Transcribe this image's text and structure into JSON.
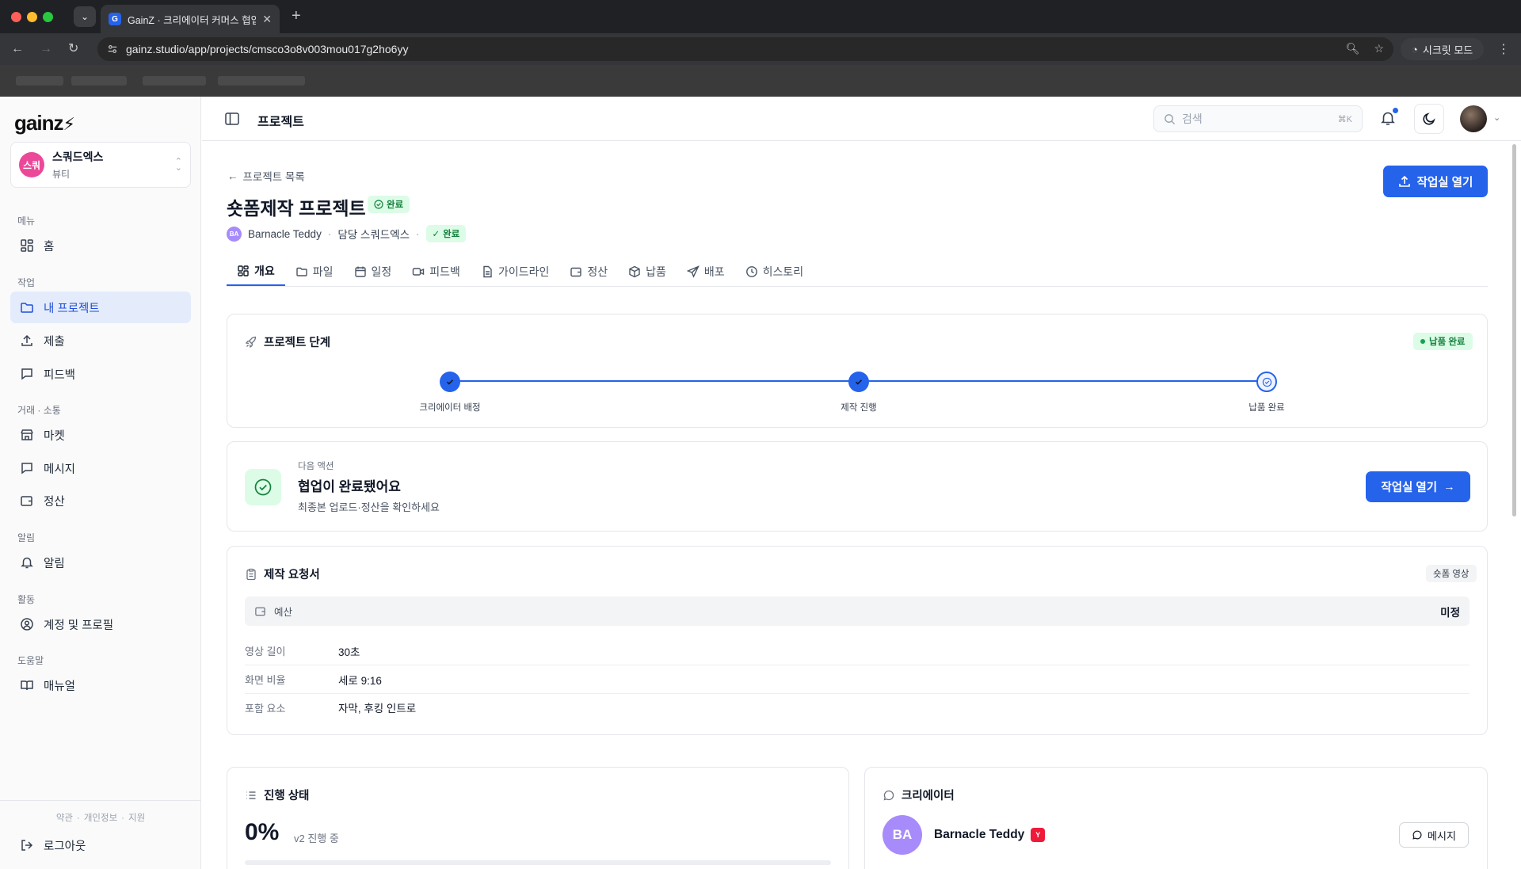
{
  "browser": {
    "tab_icon_letter": "G",
    "tab_title": "GainZ · 크리에이터 커머스 협업 C",
    "url": "gainz.studio/app/projects/cmsco3o8v003mou017g2ho6yy",
    "incognito_label": "시크릿 모드"
  },
  "sidebar": {
    "logo": "gainz",
    "workspace": {
      "avatar_text": "스쿼",
      "name": "스쿼드엑스",
      "category": "뷰티"
    },
    "sections": [
      {
        "title": "메뉴",
        "items": [
          {
            "label": "홈",
            "icon": "home-grid-icon"
          }
        ]
      },
      {
        "title": "작업",
        "items": [
          {
            "label": "내 프로젝트",
            "icon": "folder-icon",
            "active": true
          },
          {
            "label": "제출",
            "icon": "upload-icon"
          },
          {
            "label": "피드백",
            "icon": "message-square-icon"
          }
        ]
      },
      {
        "title": "거래 · 소통",
        "items": [
          {
            "label": "마켓",
            "icon": "store-icon"
          },
          {
            "label": "메시지",
            "icon": "message-icon"
          },
          {
            "label": "정산",
            "icon": "wallet-icon"
          }
        ]
      },
      {
        "title": "알림",
        "items": [
          {
            "label": "알림",
            "icon": "bell-icon"
          }
        ]
      },
      {
        "title": "활동",
        "items": [
          {
            "label": "계정 및 프로필",
            "icon": "user-circle-icon"
          }
        ]
      },
      {
        "title": "도움말",
        "items": [
          {
            "label": "매뉴얼",
            "icon": "book-icon"
          }
        ]
      }
    ],
    "footer_links": [
      "약관",
      "개인정보",
      "지원"
    ],
    "logout_label": "로그아웃"
  },
  "topbar": {
    "title": "프로젝트",
    "search_placeholder": "검색",
    "search_shortcut": "⌘K"
  },
  "project": {
    "back_label": "프로젝트 목록",
    "title": "숏폼제작 프로젝트",
    "status": "완료",
    "creator": "Barnacle Teddy",
    "creator_initials": "BA",
    "manager": "담당 스쿼드엑스",
    "status2": "완료",
    "open_workspace_label": "작업실 열기"
  },
  "tabs": [
    {
      "label": "개요",
      "icon": "grid-icon",
      "active": true
    },
    {
      "label": "파일",
      "icon": "folder-icon"
    },
    {
      "label": "일정",
      "icon": "calendar-icon"
    },
    {
      "label": "피드백",
      "icon": "video-icon"
    },
    {
      "label": "가이드라인",
      "icon": "document-icon"
    },
    {
      "label": "정산",
      "icon": "wallet-icon"
    },
    {
      "label": "납품",
      "icon": "package-icon"
    },
    {
      "label": "배포",
      "icon": "send-icon"
    },
    {
      "label": "히스토리",
      "icon": "clock-icon"
    }
  ],
  "stages": {
    "title": "프로젝트 단계",
    "status_pill": "납품 완료",
    "steps": [
      {
        "label": "크리에이터 배정",
        "state": "done"
      },
      {
        "label": "제작 진행",
        "state": "done"
      },
      {
        "label": "납품 완료",
        "state": "current"
      }
    ]
  },
  "next_action": {
    "eyebrow": "다음 액션",
    "title": "협업이 완료됐어요",
    "description": "최종본 업로드·정산을 확인하세요",
    "button_label": "작업실 열기"
  },
  "request": {
    "title": "제작 요청서",
    "type_pill": "숏폼 영상",
    "budget_label": "예산",
    "budget_value": "미정",
    "specs": [
      {
        "key": "영상 길이",
        "value": "30초"
      },
      {
        "key": "화면 비율",
        "value": "세로 9:16"
      },
      {
        "key": "포함 요소",
        "value": "자막, 후킹 인트로"
      }
    ]
  },
  "progress": {
    "title": "진행 상태",
    "percent_text": "0%",
    "percent": 0,
    "subtitle": "v2 진행 중"
  },
  "creator_card": {
    "title": "크리에이터",
    "initials": "BA",
    "name": "Barnacle Teddy",
    "platform_icon": "youtube-icon",
    "message_label": "메시지"
  },
  "colors": {
    "accent": "#2563eb",
    "success": "#15803d",
    "success_bg": "#dcfce7"
  }
}
